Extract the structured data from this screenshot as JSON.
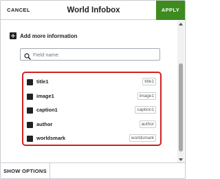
{
  "dialog": {
    "title": "World Infobox",
    "cancel_label": "CANCEL",
    "apply_label": "APPLY"
  },
  "add_more": {
    "label": "Add more information",
    "icon": "plus-square-icon"
  },
  "search": {
    "placeholder": "Field name",
    "value": "",
    "icon": "search-icon"
  },
  "params": [
    {
      "label": "title1",
      "key": "title1"
    },
    {
      "label": "image1",
      "key": "image1"
    },
    {
      "label": "caption1",
      "key": "caption1"
    },
    {
      "label": "author",
      "key": "author"
    },
    {
      "label": "worldsmark",
      "key": "worldsmark"
    }
  ],
  "footer": {
    "show_options_label": "SHOW OPTIONS"
  },
  "colors": {
    "apply_bg": "#3e8b1f",
    "highlight_border": "#d11f1f",
    "text": "#202122",
    "border": "#c8ccd1"
  }
}
